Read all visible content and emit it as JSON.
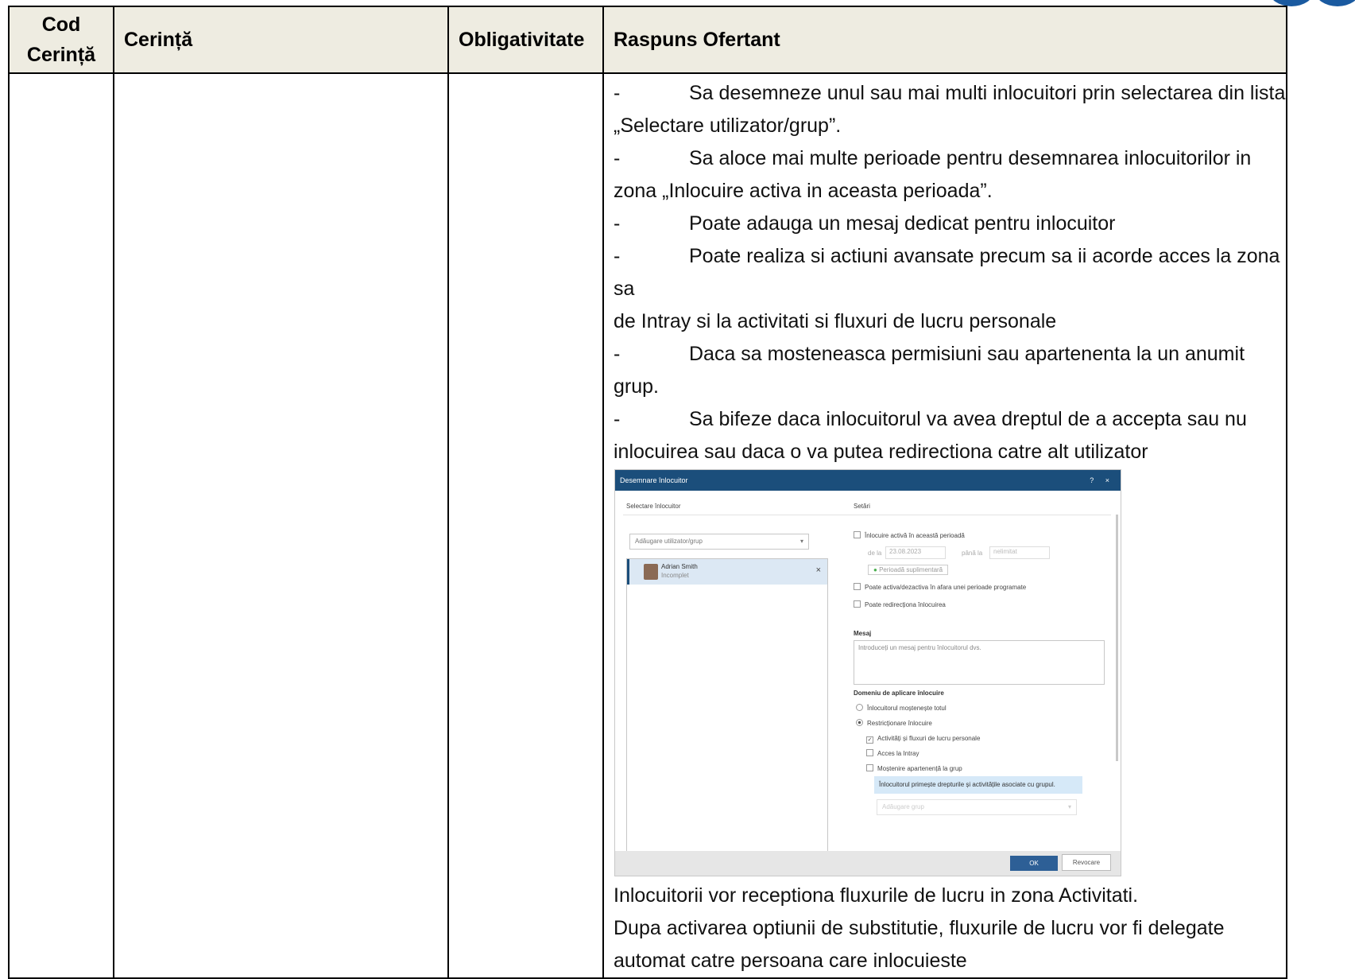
{
  "table": {
    "headers": [
      "Cod Cerință",
      "Cerință",
      "Obligativitate",
      "Raspuns Ofertant"
    ],
    "header_code_line1": "Cod",
    "header_code_line2": "Cerință",
    "response": {
      "bullets": [
        {
          "dash": "-",
          "first": "Sa desemneze unul sau mai multi inlocuitori prin selectarea din lista",
          "rest": "„Selectare utilizator/grup”."
        },
        {
          "dash": "-",
          "first": "Sa aloce mai multe perioade pentru desemnarea inlocuitorilor in",
          "rest": "zona „Inlocuire activa in aceasta perioada”."
        },
        {
          "dash": "-",
          "first": "Poate adauga un mesaj dedicat pentru inlocuitor",
          "rest": ""
        },
        {
          "dash": "-",
          "first": "Poate realiza si actiuni avansate precum sa ii acorde acces la zona sa",
          "rest": "de Intray si la activitati si fluxuri de lucru personale"
        },
        {
          "dash": "-",
          "first": "Daca sa mosteneasca permisiuni sau apartenenta la un anumit grup.",
          "rest": ""
        },
        {
          "dash": "-",
          "first": "Sa bifeze daca inlocuitorul va avea dreptul de a accepta sau nu",
          "rest": "inlocuirea sau daca o va putea redirectiona catre alt utilizator"
        }
      ],
      "after_lines": [
        "Inlocuitorii vor receptiona fluxurile de lucru in zona Activitati.",
        "Dupa activarea optiunii de substitutie, fluxurile de lucru vor fi delegate",
        "automat catre persoana care inlocuieste"
      ]
    }
  },
  "dialog": {
    "title": "Desemnare înlocuitor",
    "title_icons": "? ×",
    "left_header": "Selectare înlocuitor",
    "right_header": "Setări",
    "add_user_placeholder": "Adăugare utilizator/grup",
    "user_name": "Adrian Smith",
    "user_status": "Incomplet",
    "remove_icon": "×",
    "active_period_label": "Înlocuire activă în această perioadă",
    "from_label": "de la",
    "from_date": "23.08.2023",
    "to_label": "până la",
    "to_value": "nelimitat",
    "extra_period_button": "Perioadă suplimentară",
    "can_toggle_label": "Poate activa/dezactiva în afara unei perioade programate",
    "can_redirect_label": "Poate redirecționa înlocuirea",
    "message_heading": "Mesaj",
    "message_placeholder": "Introduceți un mesaj pentru înlocuitorul dvs.",
    "scope_heading": "Domeniu de aplicare înlocuire",
    "inherit_all_label": "Înlocuitorul moștenește totul",
    "restrict_label": "Restricționare înlocuire",
    "activities_label": "Activități și fluxuri de lucru personale",
    "intray_label": "Acces la Intray",
    "group_inherit_label": "Moștenire apartenență la grup",
    "group_info": "Înlocuitorul primește drepturile și activitățile asociate cu grupul.",
    "add_group_placeholder": "Adăugare grup",
    "ok_button": "OK",
    "cancel_button": "Revocare"
  },
  "colors": {
    "header_bg": "#eeece1",
    "dialog_titlebar": "#1b4e7b",
    "ok_button": "#2d5f96",
    "info_box": "#d6e9f8"
  }
}
